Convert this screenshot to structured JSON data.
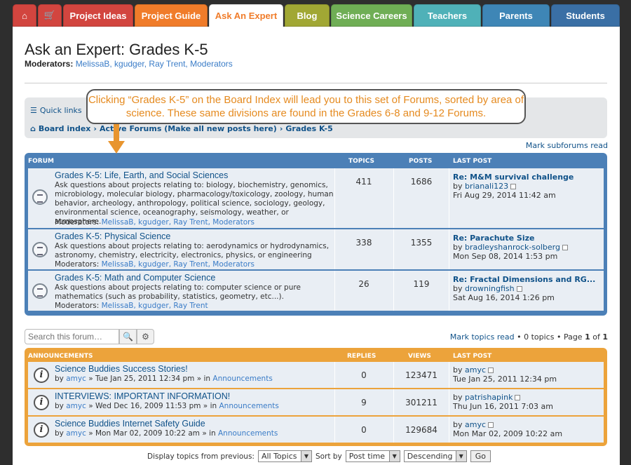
{
  "nav": {
    "tabs": [
      {
        "label": "",
        "icon": "home-icon",
        "color": "#d2453f"
      },
      {
        "label": "",
        "icon": "cart-icon",
        "color": "#d2453f"
      },
      {
        "label": "Project Ideas",
        "color": "#d2453f"
      },
      {
        "label": "Project Guide",
        "color": "#f07c2a"
      },
      {
        "label": "Ask An Expert",
        "color": "#ffffff"
      },
      {
        "label": "Blog",
        "color": "#a1a734"
      },
      {
        "label": "Science Careers",
        "color": "#6fae55"
      },
      {
        "label": "Teachers",
        "color": "#4fb1b8"
      },
      {
        "label": "Parents",
        "color": "#3e86b6"
      },
      {
        "label": "Students",
        "color": "#3a6fa5"
      }
    ]
  },
  "header": {
    "title": "Ask an Expert: Grades K-5",
    "moderators_label": "Moderators:",
    "moderators": "MelissaB, kgudger, Ray Trent, Moderators"
  },
  "navbar": {
    "quick_links": "Quick links",
    "breadcrumbs": [
      "Board index",
      "Active Forums (Make all new posts here)",
      "Grades K-5"
    ]
  },
  "callout": "Clicking “Grades K-5” on the Board Index will lead you to this set of Forums, sorted by area of science.  These same divisions are found in the Grades 6-8 and 9-12 Forums.",
  "mark_subforums": "Mark subforums read",
  "forums": {
    "headers": {
      "forum": "FORUM",
      "topics": "TOPICS",
      "posts": "POSTS",
      "last": "LAST POST"
    },
    "rows": [
      {
        "title": "Grades K-5: Life, Earth, and Social Sciences",
        "desc": "Ask questions about projects relating to: biology, biochemistry, genomics, microbiology, molecular biology, pharmacology/toxicology, zoology, human behavior, archeology, anthropology, political science, sociology, geology, environmental science, oceanography, seismology, weather, or atmosphere.",
        "mods_label": "Moderators:",
        "mods": "MelissaB, kgudger, Ray Trent, Moderators",
        "topics": "411",
        "posts": "1686",
        "last_title": "Re: M&M survival challenge",
        "last_by": "by",
        "last_user": "brianali123",
        "last_date": "Fri Aug 29, 2014 11:42 am"
      },
      {
        "title": "Grades K-5: Physical Science",
        "desc": "Ask questions about projects relating to: aerodynamics or hydrodynamics, astronomy, chemistry, electricity, electronics, physics, or engineering",
        "mods_label": "Moderators:",
        "mods": "MelissaB, kgudger, Ray Trent, Moderators",
        "topics": "338",
        "posts": "1355",
        "last_title": "Re: Parachute Size",
        "last_by": "by",
        "last_user": "bradleyshanrock-solberg",
        "last_date": "Mon Sep 08, 2014 1:53 pm"
      },
      {
        "title": "Grades K-5: Math and Computer Science",
        "desc": "Ask questions about projects relating to: computer science or pure mathematics (such as probability, statistics, geometry, etc...).",
        "mods_label": "Moderators:",
        "mods": "MelissaB, kgudger, Ray Trent",
        "topics": "26",
        "posts": "119",
        "last_title": "Re: Fractal Dimensions and RG...",
        "last_by": "by",
        "last_user": "drowningfish",
        "last_date": "Sat Aug 16, 2014 1:26 pm"
      }
    ]
  },
  "search": {
    "placeholder": "Search this forum…"
  },
  "pagination": {
    "mark_topics": "Mark topics read",
    "text": " • 0 topics • Page ",
    "page": "1",
    "of": " of ",
    "total": "1"
  },
  "announcements": {
    "headers": {
      "title": "ANNOUNCEMENTS",
      "replies": "REPLIES",
      "views": "VIEWS",
      "last": "LAST POST"
    },
    "rows": [
      {
        "title": "Science Buddies Success Stories!",
        "by": "by",
        "user": "amyc",
        "date": "» Tue Jan 25, 2011 12:34 pm » in",
        "forum": "Announcements",
        "replies": "0",
        "views": "123471",
        "last_by": "by",
        "last_user": "amyc",
        "last_date": "Tue Jan 25, 2011 12:34 pm"
      },
      {
        "title": "INTERVIEWS: IMPORTANT INFORMATION!",
        "by": "by",
        "user": "amyc",
        "date": "» Wed Dec 16, 2009 11:53 pm » in",
        "forum": "Announcements",
        "replies": "9",
        "views": "301211",
        "last_by": "by",
        "last_user": "patrishapink",
        "last_date": "Thu Jun 16, 2011 7:03 am"
      },
      {
        "title": "Science Buddies Internet Safety Guide",
        "by": "by",
        "user": "amyc",
        "date": "» Mon Mar 02, 2009 10:22 am » in",
        "forum": "Announcements",
        "replies": "0",
        "views": "129684",
        "last_by": "by",
        "last_user": "amyc",
        "last_date": "Mon Mar 02, 2009 10:22 am"
      }
    ]
  },
  "bottom": {
    "display_label": "Display topics from previous:",
    "display_value": "All Topics",
    "sort_label": "Sort by",
    "sort_value": "Post time",
    "order_value": "Descending",
    "go": "Go"
  }
}
